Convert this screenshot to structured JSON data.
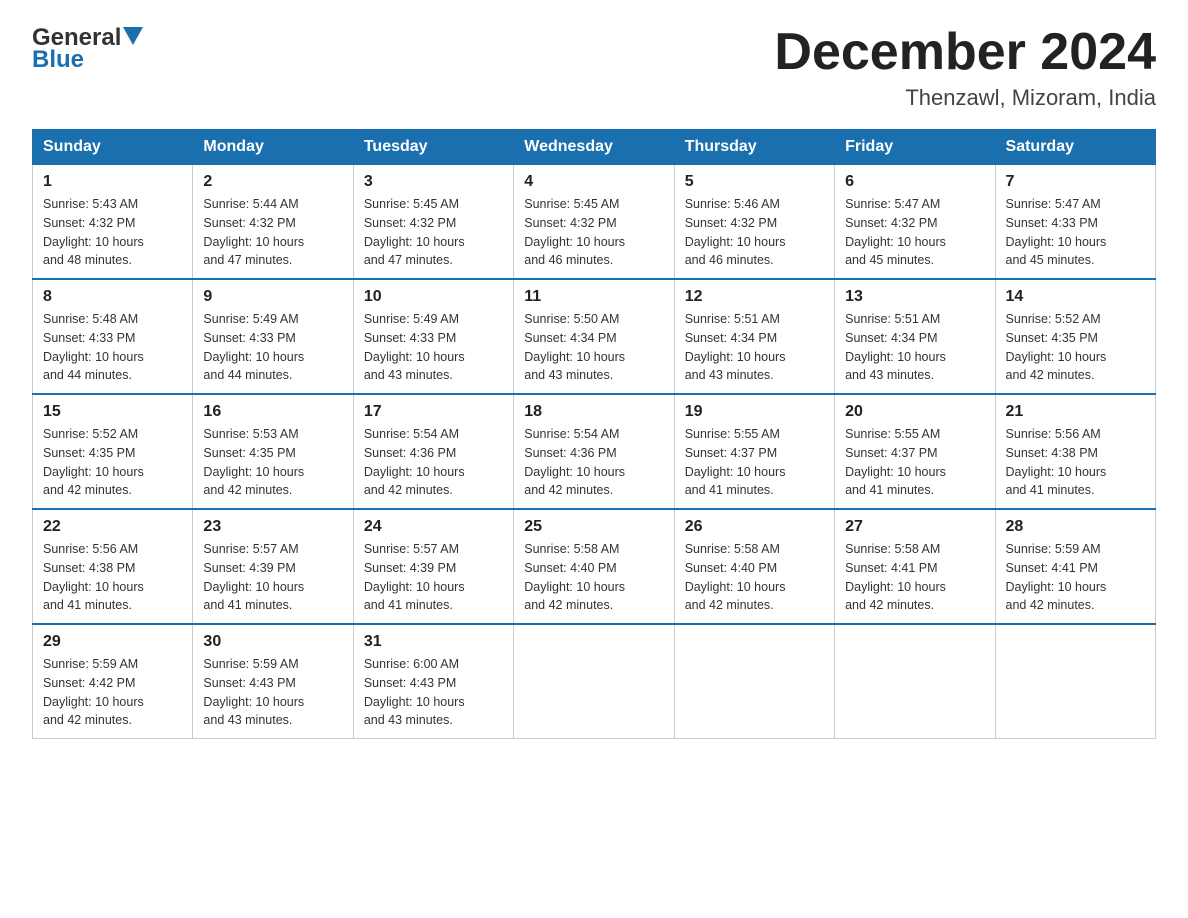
{
  "header": {
    "logo_general": "General",
    "logo_blue": "Blue",
    "month_title": "December 2024",
    "location": "Thenzawl, Mizoram, India"
  },
  "days_of_week": [
    "Sunday",
    "Monday",
    "Tuesday",
    "Wednesday",
    "Thursday",
    "Friday",
    "Saturday"
  ],
  "weeks": [
    [
      {
        "day": "1",
        "sunrise": "5:43 AM",
        "sunset": "4:32 PM",
        "daylight": "10 hours and 48 minutes."
      },
      {
        "day": "2",
        "sunrise": "5:44 AM",
        "sunset": "4:32 PM",
        "daylight": "10 hours and 47 minutes."
      },
      {
        "day": "3",
        "sunrise": "5:45 AM",
        "sunset": "4:32 PM",
        "daylight": "10 hours and 47 minutes."
      },
      {
        "day": "4",
        "sunrise": "5:45 AM",
        "sunset": "4:32 PM",
        "daylight": "10 hours and 46 minutes."
      },
      {
        "day": "5",
        "sunrise": "5:46 AM",
        "sunset": "4:32 PM",
        "daylight": "10 hours and 46 minutes."
      },
      {
        "day": "6",
        "sunrise": "5:47 AM",
        "sunset": "4:32 PM",
        "daylight": "10 hours and 45 minutes."
      },
      {
        "day": "7",
        "sunrise": "5:47 AM",
        "sunset": "4:33 PM",
        "daylight": "10 hours and 45 minutes."
      }
    ],
    [
      {
        "day": "8",
        "sunrise": "5:48 AM",
        "sunset": "4:33 PM",
        "daylight": "10 hours and 44 minutes."
      },
      {
        "day": "9",
        "sunrise": "5:49 AM",
        "sunset": "4:33 PM",
        "daylight": "10 hours and 44 minutes."
      },
      {
        "day": "10",
        "sunrise": "5:49 AM",
        "sunset": "4:33 PM",
        "daylight": "10 hours and 43 minutes."
      },
      {
        "day": "11",
        "sunrise": "5:50 AM",
        "sunset": "4:34 PM",
        "daylight": "10 hours and 43 minutes."
      },
      {
        "day": "12",
        "sunrise": "5:51 AM",
        "sunset": "4:34 PM",
        "daylight": "10 hours and 43 minutes."
      },
      {
        "day": "13",
        "sunrise": "5:51 AM",
        "sunset": "4:34 PM",
        "daylight": "10 hours and 43 minutes."
      },
      {
        "day": "14",
        "sunrise": "5:52 AM",
        "sunset": "4:35 PM",
        "daylight": "10 hours and 42 minutes."
      }
    ],
    [
      {
        "day": "15",
        "sunrise": "5:52 AM",
        "sunset": "4:35 PM",
        "daylight": "10 hours and 42 minutes."
      },
      {
        "day": "16",
        "sunrise": "5:53 AM",
        "sunset": "4:35 PM",
        "daylight": "10 hours and 42 minutes."
      },
      {
        "day": "17",
        "sunrise": "5:54 AM",
        "sunset": "4:36 PM",
        "daylight": "10 hours and 42 minutes."
      },
      {
        "day": "18",
        "sunrise": "5:54 AM",
        "sunset": "4:36 PM",
        "daylight": "10 hours and 42 minutes."
      },
      {
        "day": "19",
        "sunrise": "5:55 AM",
        "sunset": "4:37 PM",
        "daylight": "10 hours and 41 minutes."
      },
      {
        "day": "20",
        "sunrise": "5:55 AM",
        "sunset": "4:37 PM",
        "daylight": "10 hours and 41 minutes."
      },
      {
        "day": "21",
        "sunrise": "5:56 AM",
        "sunset": "4:38 PM",
        "daylight": "10 hours and 41 minutes."
      }
    ],
    [
      {
        "day": "22",
        "sunrise": "5:56 AM",
        "sunset": "4:38 PM",
        "daylight": "10 hours and 41 minutes."
      },
      {
        "day": "23",
        "sunrise": "5:57 AM",
        "sunset": "4:39 PM",
        "daylight": "10 hours and 41 minutes."
      },
      {
        "day": "24",
        "sunrise": "5:57 AM",
        "sunset": "4:39 PM",
        "daylight": "10 hours and 41 minutes."
      },
      {
        "day": "25",
        "sunrise": "5:58 AM",
        "sunset": "4:40 PM",
        "daylight": "10 hours and 42 minutes."
      },
      {
        "day": "26",
        "sunrise": "5:58 AM",
        "sunset": "4:40 PM",
        "daylight": "10 hours and 42 minutes."
      },
      {
        "day": "27",
        "sunrise": "5:58 AM",
        "sunset": "4:41 PM",
        "daylight": "10 hours and 42 minutes."
      },
      {
        "day": "28",
        "sunrise": "5:59 AM",
        "sunset": "4:41 PM",
        "daylight": "10 hours and 42 minutes."
      }
    ],
    [
      {
        "day": "29",
        "sunrise": "5:59 AM",
        "sunset": "4:42 PM",
        "daylight": "10 hours and 42 minutes."
      },
      {
        "day": "30",
        "sunrise": "5:59 AM",
        "sunset": "4:43 PM",
        "daylight": "10 hours and 43 minutes."
      },
      {
        "day": "31",
        "sunrise": "6:00 AM",
        "sunset": "4:43 PM",
        "daylight": "10 hours and 43 minutes."
      },
      null,
      null,
      null,
      null
    ]
  ],
  "labels": {
    "sunrise": "Sunrise:",
    "sunset": "Sunset:",
    "daylight": "Daylight:"
  }
}
